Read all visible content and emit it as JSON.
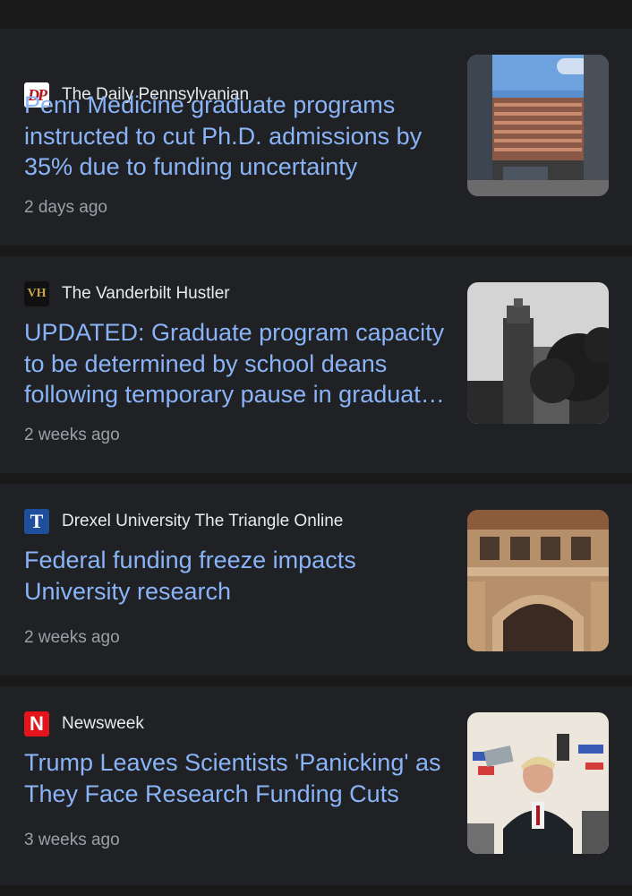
{
  "articles": [
    {
      "source": "The Daily Pennsylvanian",
      "logo_text": "DP",
      "headline": "Penn Medicine graduate programs instructed to cut Ph.D. admissions by 35% due to funding uncertainty",
      "time": "2 days ago"
    },
    {
      "source": "The Vanderbilt Hustler",
      "logo_text": "VH",
      "headline": "UPDATED: Graduate program capacity to be determined by school deans following temporary pause in graduate admissions",
      "time": "2 weeks ago"
    },
    {
      "source": "Drexel University The Triangle Online",
      "logo_text": "T",
      "headline": "Federal funding freeze impacts University research",
      "time": "2 weeks ago"
    },
    {
      "source": "Newsweek",
      "logo_text": "N",
      "headline": "Trump Leaves Scientists 'Panicking' as They Face Research Funding Cuts",
      "time": "3 weeks ago"
    }
  ],
  "colors": {
    "background": "#1a1a1b",
    "card": "#202124",
    "headline": "#8ab4f8",
    "source": "#e8eaed",
    "timestamp": "#9aa0a6"
  }
}
